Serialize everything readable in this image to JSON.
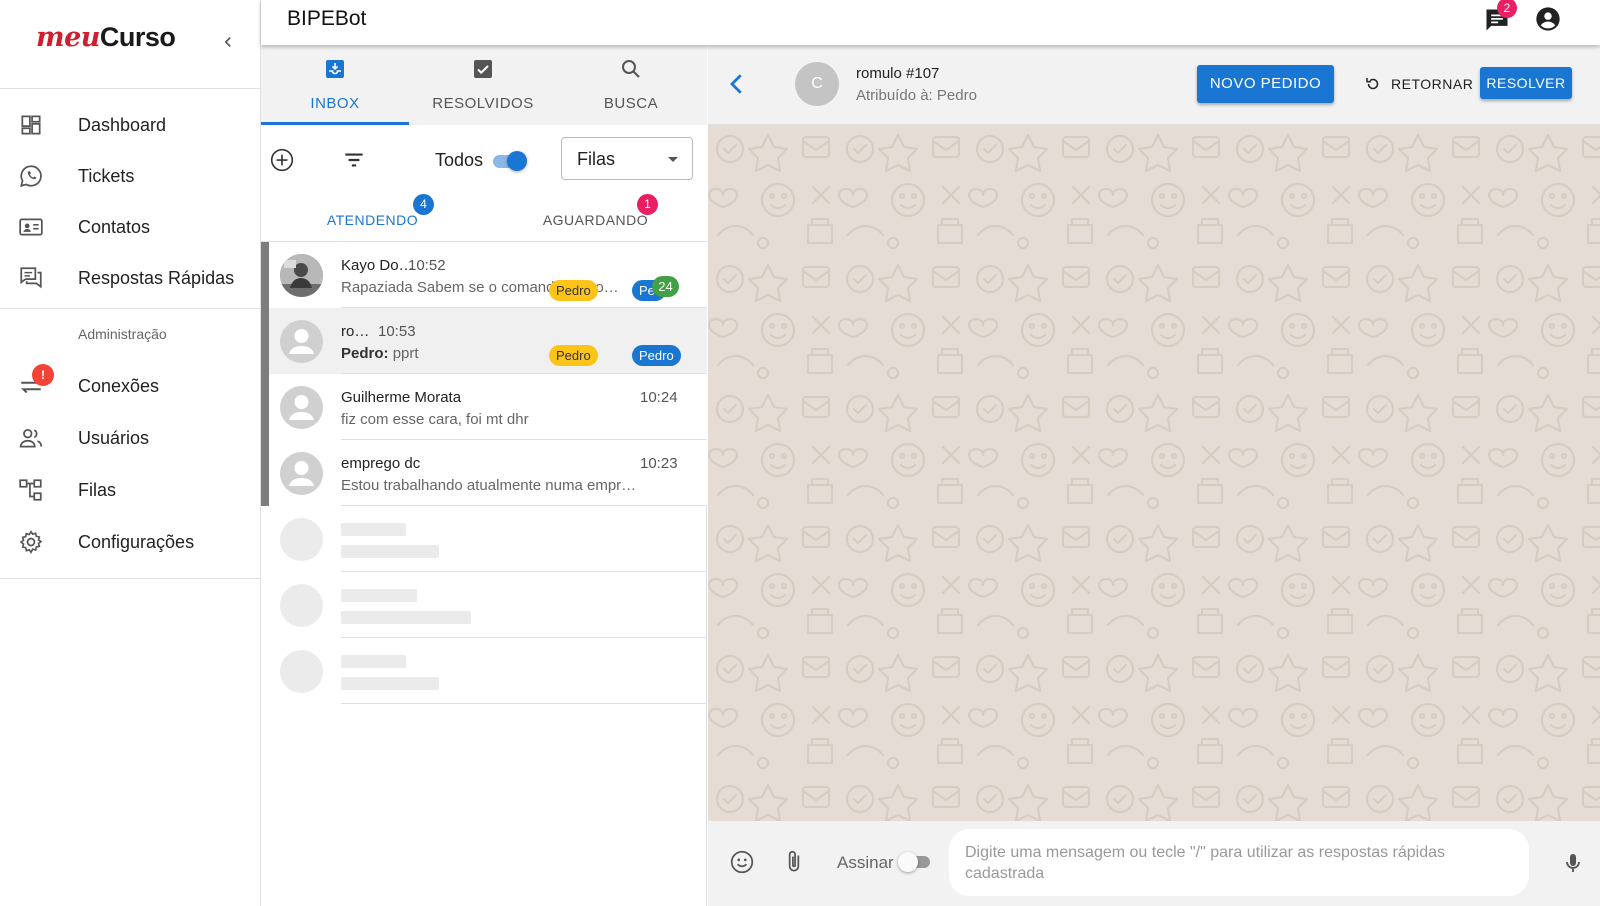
{
  "sidebar": {
    "logo_part1": "meu",
    "logo_part2": "Curso",
    "items": [
      {
        "label": "Dashboard",
        "icon": "dashboard-icon"
      },
      {
        "label": "Tickets",
        "icon": "whatsapp-icon"
      },
      {
        "label": "Contatos",
        "icon": "contact-card-icon"
      },
      {
        "label": "Respostas Rápidas",
        "icon": "quick-reply-icon"
      }
    ],
    "admin_section_label": "Administração",
    "admin_items": [
      {
        "label": "Conexões",
        "icon": "sync-alt-icon",
        "badge": "!"
      },
      {
        "label": "Usuários",
        "icon": "people-icon"
      },
      {
        "label": "Filas",
        "icon": "account-tree-icon"
      },
      {
        "label": "Configurações",
        "icon": "gear-icon"
      }
    ]
  },
  "appbar": {
    "title": "BIPEBot",
    "notifications_count": "2"
  },
  "tickets_panel": {
    "tabs": [
      {
        "label": "INBOX",
        "icon": "inbox-icon",
        "active": true
      },
      {
        "label": "RESOLVIDOS",
        "icon": "checkbox-icon",
        "active": false
      },
      {
        "label": "BUSCA",
        "icon": "search-icon",
        "active": false
      }
    ],
    "todos_label": "Todos",
    "todos_enabled": true,
    "filas_select_value": "Filas",
    "sub_tabs": [
      {
        "label": "ATENDENDO",
        "badge": "4",
        "badge_color": "#1976d2"
      },
      {
        "label": "AGUARDANDO",
        "badge": "1",
        "badge_color": "#e91e63"
      }
    ],
    "tickets": [
      {
        "name": "Kayo Do…",
        "time": "10:52",
        "message": "Rapaziada Sabem se o comando l é bo…",
        "sender": "",
        "queue_chip": "Pedro",
        "user_chip": "Pe",
        "unread": "24",
        "selected": false
      },
      {
        "name": "ro…",
        "time": "10:53",
        "message": "pprt",
        "sender": "Pedro:",
        "queue_chip": "Pedro",
        "user_chip": "Pedro",
        "unread": "",
        "selected": true
      },
      {
        "name": "Guilherme Morata",
        "time": "10:24",
        "message": "fiz com esse cara, foi mt dhr",
        "sender": "",
        "queue_chip": "",
        "user_chip": "",
        "unread": "",
        "selected": false
      },
      {
        "name": "emprego dc",
        "time": "10:23",
        "message": "Estou trabalhando atualmente numa empr…",
        "sender": "",
        "queue_chip": "",
        "user_chip": "",
        "unread": "",
        "selected": false
      }
    ]
  },
  "chat": {
    "contact_initial": "C",
    "contact_name": "romulo #107",
    "assigned_to": "Atribuído à: Pedro",
    "buttons": {
      "novo_pedido": "NOVO PEDIDO",
      "retornar": "RETORNAR",
      "resolver": "RESOLVER"
    },
    "composer": {
      "assinar_label": "Assinar",
      "assinar_enabled": false,
      "placeholder": "Digite uma mensagem ou tecle \"/\" para utilizar as respostas rápidas cadastrada"
    }
  },
  "colors": {
    "primary": "#1976d2",
    "brand_red": "#d01e2e",
    "chat_background": "#e5ddd5",
    "badge_red": "#f44336",
    "badge_pink": "#e91e63",
    "chip_yellow": "#fcc419",
    "unread_green": "#43a047"
  }
}
